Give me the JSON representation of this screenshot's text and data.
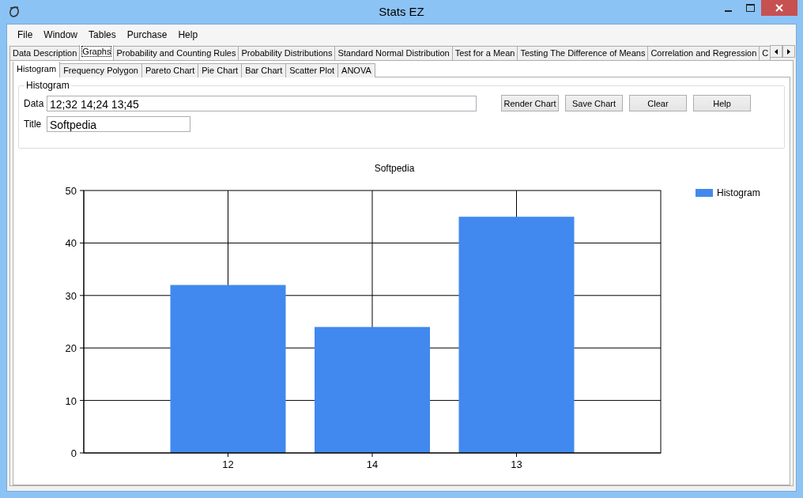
{
  "window": {
    "title": "Stats EZ"
  },
  "menu": [
    "File",
    "Window",
    "Tables",
    "Purchase",
    "Help"
  ],
  "tabs": [
    {
      "label": "Data Description",
      "selected": false
    },
    {
      "label": "Graphs",
      "selected": true
    },
    {
      "label": "Probability and Counting Rules",
      "selected": false
    },
    {
      "label": "Probability Distributions",
      "selected": false
    },
    {
      "label": "Standard Normal Distribution",
      "selected": false
    },
    {
      "label": "Test for a Mean",
      "selected": false
    },
    {
      "label": "Testing The Difference of Means",
      "selected": false
    },
    {
      "label": "Correlation and Regression",
      "selected": false
    },
    {
      "label": "C",
      "selected": false
    }
  ],
  "subtabs": [
    {
      "label": "Histogram",
      "selected": true
    },
    {
      "label": "Frequency Polygon",
      "selected": false
    },
    {
      "label": "Pareto Chart",
      "selected": false
    },
    {
      "label": "Pie Chart",
      "selected": false
    },
    {
      "label": "Bar Chart",
      "selected": false
    },
    {
      "label": "Scatter Plot",
      "selected": false
    },
    {
      "label": "ANOVA",
      "selected": false
    }
  ],
  "group": {
    "title": "Histogram",
    "fields": [
      {
        "label": "Data",
        "value": "12;32 14;24 13;45"
      },
      {
        "label": "Title",
        "value": "Softpedia"
      }
    ],
    "buttons": [
      "Render Chart",
      "Save Chart",
      "Clear",
      "Help"
    ]
  },
  "chart": {
    "chart_data": {
      "type": "bar",
      "title": "Softpedia",
      "categories": [
        "12",
        "14",
        "13"
      ],
      "series": [
        {
          "name": "Histogram",
          "color": "#4189ef",
          "values": [
            32,
            24,
            45
          ]
        }
      ],
      "grid": true,
      "ylim": [
        0,
        50
      ],
      "yticks": [
        0,
        10,
        20,
        30,
        40,
        50
      ]
    }
  }
}
